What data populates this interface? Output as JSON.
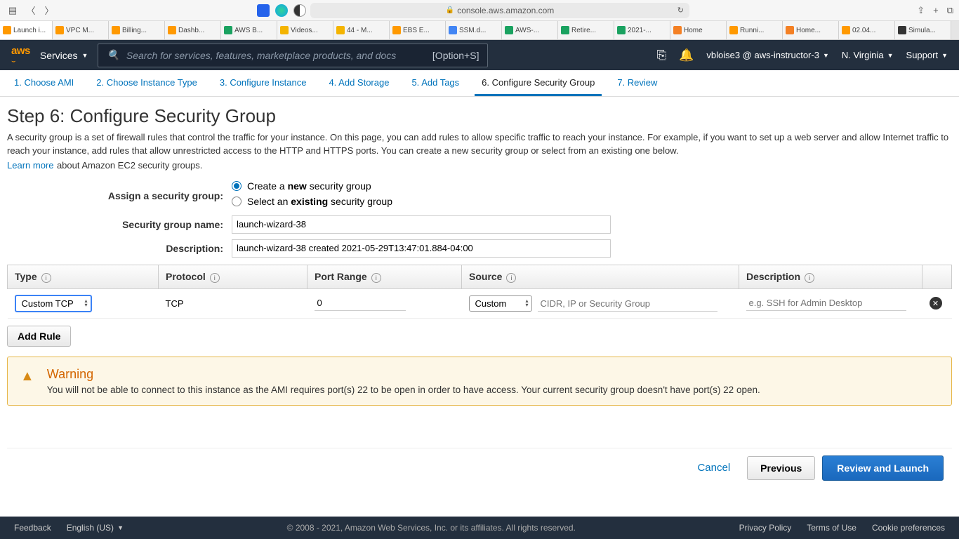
{
  "browser": {
    "url": "console.aws.amazon.com",
    "tabs": [
      {
        "label": "Launch i...",
        "fav": "#ff9900"
      },
      {
        "label": "VPC M...",
        "fav": "#ff9900"
      },
      {
        "label": "Billing...",
        "fav": "#ff9900"
      },
      {
        "label": "Dashb...",
        "fav": "#ff9900"
      },
      {
        "label": "AWS B...",
        "fav": "#1aa260"
      },
      {
        "label": "Videos...",
        "fav": "#f4b400"
      },
      {
        "label": "44 - M...",
        "fav": "#f4b400"
      },
      {
        "label": "EBS E...",
        "fav": "#ff9900"
      },
      {
        "label": "SSM.d...",
        "fav": "#4285f4"
      },
      {
        "label": "AWS-...",
        "fav": "#1aa260"
      },
      {
        "label": "Retire...",
        "fav": "#1aa260"
      },
      {
        "label": "2021-...",
        "fav": "#1aa260"
      },
      {
        "label": "Home",
        "fav": "#f48024"
      },
      {
        "label": "Runni...",
        "fav": "#ff9900"
      },
      {
        "label": "Home...",
        "fav": "#f48024"
      },
      {
        "label": "02.04...",
        "fav": "#ff9900"
      },
      {
        "label": "Simula...",
        "fav": "#333333"
      }
    ]
  },
  "aws_header": {
    "logo": "aws",
    "services": "Services",
    "search_placeholder": "Search for services, features, marketplace products, and docs",
    "search_shortcut": "[Option+S]",
    "account": "vbloise3 @ aws-instructor-3",
    "region": "N. Virginia",
    "support": "Support"
  },
  "wizard": {
    "tabs": [
      "1. Choose AMI",
      "2. Choose Instance Type",
      "3. Configure Instance",
      "4. Add Storage",
      "5. Add Tags",
      "6. Configure Security Group",
      "7. Review"
    ],
    "active_index": 5
  },
  "page": {
    "title": "Step 6: Configure Security Group",
    "desc": "A security group is a set of firewall rules that control the traffic for your instance. On this page, you can add rules to allow specific traffic to reach your instance. For example, if you want to set up a web server and allow Internet traffic to reach your instance, add rules that allow unrestricted access to the HTTP and HTTPS ports. You can create a new security group or select from an existing one below.",
    "learn_more": "Learn more",
    "learn_more_suffix": " about Amazon EC2 security groups."
  },
  "form": {
    "assign_label": "Assign a security group:",
    "option_create_parts": [
      "Create a ",
      "new",
      " security group"
    ],
    "option_existing_parts": [
      "Select an ",
      "existing",
      " security group"
    ],
    "selected_option": "create",
    "name_label": "Security group name:",
    "name_value": "launch-wizard-38",
    "desc_label": "Description:",
    "desc_value": "launch-wizard-38 created 2021-05-29T13:47:01.884-04:00"
  },
  "table": {
    "headers": [
      "Type",
      "Protocol",
      "Port Range",
      "Source",
      "Description"
    ],
    "rows": [
      {
        "type": "Custom TCP",
        "protocol": "TCP",
        "port_range": "0",
        "source_mode": "Custom",
        "source_value": "",
        "source_placeholder": "CIDR, IP or Security Group",
        "description": "",
        "description_placeholder": "e.g. SSH for Admin Desktop"
      }
    ],
    "add_rule": "Add Rule"
  },
  "warning": {
    "title": "Warning",
    "text": "You will not be able to connect to this instance as the AMI requires port(s) 22 to be open in order to have access. Your current security group doesn't have port(s) 22 open."
  },
  "actions": {
    "cancel": "Cancel",
    "previous": "Previous",
    "review": "Review and Launch"
  },
  "footer": {
    "feedback": "Feedback",
    "language": "English (US)",
    "copyright": "© 2008 - 2021, Amazon Web Services, Inc. or its affiliates. All rights reserved.",
    "privacy": "Privacy Policy",
    "terms": "Terms of Use",
    "cookies": "Cookie preferences"
  }
}
